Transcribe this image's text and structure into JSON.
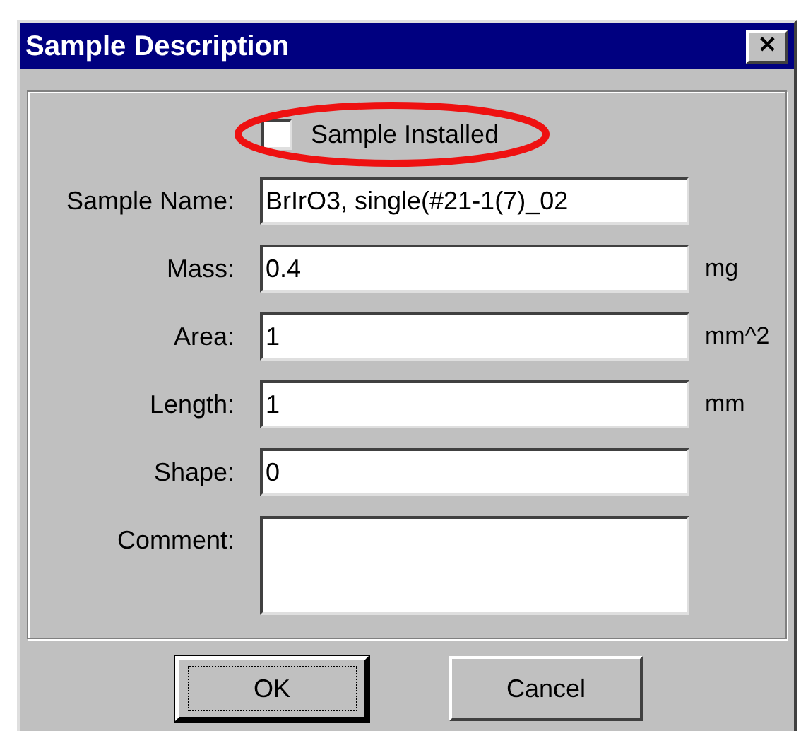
{
  "window": {
    "title": "Sample Description",
    "close": "✕"
  },
  "checkbox": {
    "label": "Sample Installed",
    "checked": false
  },
  "fields": [
    {
      "kind": "line",
      "label": "Sample Name:",
      "value": "BrIrO3, single(#21-1(7)_02"
    },
    {
      "kind": "line",
      "label": "Mass:",
      "value": "0.4",
      "unit": "mg"
    },
    {
      "kind": "line",
      "label": "Area:",
      "value": "1",
      "unit": "mm^2"
    },
    {
      "kind": "line",
      "label": "Length:",
      "value": "1",
      "unit": "mm"
    },
    {
      "kind": "line",
      "label": "Shape:",
      "value": "0"
    },
    {
      "kind": "multiline",
      "label": "Comment:"
    }
  ],
  "buttons": [
    {
      "label": "OK",
      "default": true
    },
    {
      "label": "Cancel",
      "default": false
    }
  ]
}
